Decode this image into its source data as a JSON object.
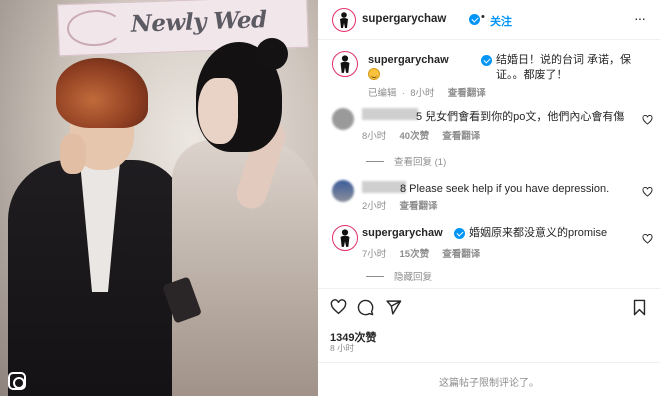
{
  "photo": {
    "banner_text": "Newly Wed"
  },
  "post": {
    "author": "supergarychaw",
    "follow_label": "关注",
    "separator": "•",
    "more_label": "···",
    "caption": {
      "username": "supergarychaw",
      "text": "结婚日！说的台词 承诺，保证。。都废了！",
      "edited": "已编辑",
      "time": "8小时",
      "translate": "查看翻译"
    },
    "comments": [
      {
        "text": "5 兒女們會看到你的po文，他們內心會有傷",
        "time": "8小时",
        "likes": "40次赞",
        "translate": "查看翻译",
        "replies": "查看回复 (1)"
      },
      {
        "text": "8 Please seek help if you have depression.",
        "time": "2小时",
        "translate": "查看翻译"
      },
      {
        "username": "supergarychaw",
        "text": "婚姻原来都没意义的promise",
        "time": "7小时",
        "likes": "15次赞",
        "translate": "查看翻译",
        "replies": "隐藏回复"
      }
    ],
    "likes_count": "1349次赞",
    "posted_time": "8 小时",
    "comments_limited": "这篇帖子限制评论了。"
  },
  "colors": {
    "link_blue": "#0095f6",
    "muted_gray": "#8e8e8e",
    "story_ring": "#e1306c"
  },
  "icons": [
    "heart-icon",
    "comment-icon",
    "share-icon",
    "bookmark-icon",
    "more-icon",
    "verified-badge-icon"
  ]
}
